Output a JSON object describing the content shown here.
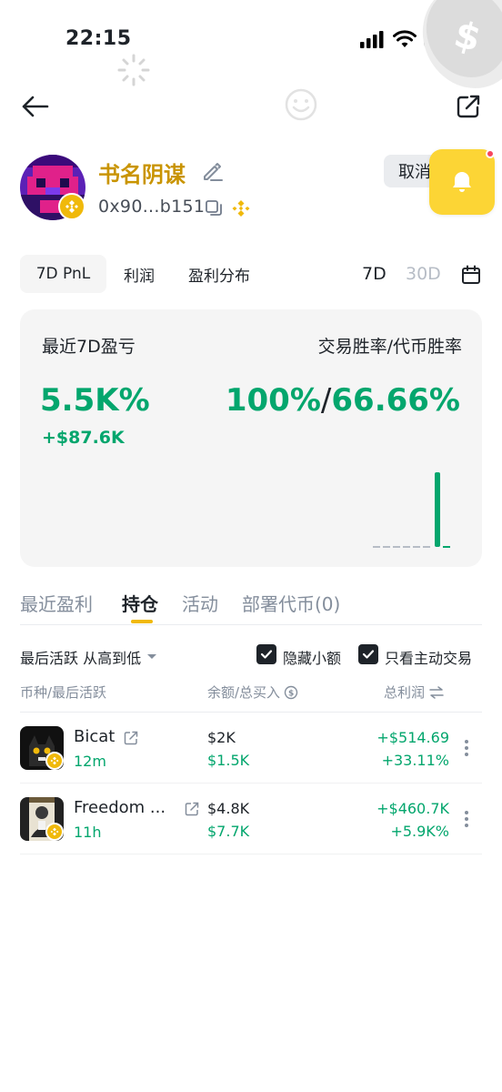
{
  "status_bar": {
    "time": "22:15"
  },
  "profile": {
    "name": "书名阴谋",
    "address": "0x90...b151",
    "cancel_label": "取消"
  },
  "stat_tabs": [
    {
      "label": "7D PnL",
      "active": true
    },
    {
      "label": "利润",
      "active": false
    },
    {
      "label": "盈利分布",
      "active": false
    }
  ],
  "ranges": [
    {
      "label": "7D",
      "active": true
    },
    {
      "label": "30D",
      "active": false
    }
  ],
  "card": {
    "left_label": "最近7D盈亏",
    "right_label": "交易胜率/代币胜率",
    "pnl_percent": "5.5K%",
    "pnl_usd": "+$87.6K",
    "trade_win_rate": "100%",
    "separator": "/",
    "token_win_rate": "66.66%",
    "bars": [
      0,
      0,
      0,
      0,
      0,
      0,
      1.0,
      0
    ]
  },
  "section_tabs": [
    {
      "label": "最近盈利",
      "active": false
    },
    {
      "label": "持仓",
      "active": true
    },
    {
      "label": "活动",
      "active": false
    },
    {
      "label": "部署代币(0)",
      "active": false
    }
  ],
  "filters": {
    "sort_label": "最后活跃 从高到低",
    "hide_small_label": "隐藏小额",
    "hide_small_checked": true,
    "active_only_label": "只看主动交易",
    "active_only_checked": true
  },
  "table": {
    "col_token": "币种/最后活跃",
    "col_balance": "余额/总买入",
    "col_pnl": "总利润",
    "rows": [
      {
        "name": "Bicat",
        "time": "12m",
        "balance": "$2K",
        "bought": "$1.5K",
        "pnl": "+$514.69",
        "pnl_pct": "+33.11%"
      },
      {
        "name": "Freedom ...",
        "time": "11h",
        "balance": "$4.8K",
        "bought": "$7.7K",
        "pnl": "+$460.7K",
        "pnl_pct": "+5.9K%"
      }
    ]
  },
  "colors": {
    "accent": "#f0b90b",
    "bell_bg": "#fcd535",
    "positive": "#03a66d",
    "name_gold": "#c99400",
    "avatar_purple": "#5b21b6",
    "avatar_pink": "#e0218a"
  }
}
